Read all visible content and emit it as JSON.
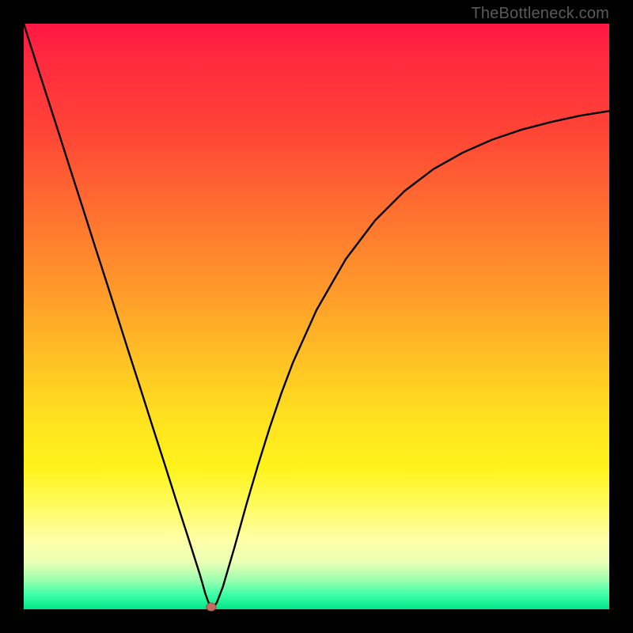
{
  "watermark": "TheBottleneck.com",
  "chart_data": {
    "type": "line",
    "title": "",
    "xlabel": "",
    "ylabel": "",
    "ylim": [
      0,
      100
    ],
    "xlim": [
      0,
      100
    ],
    "x": [
      0,
      2,
      4,
      6,
      8,
      10,
      12,
      14,
      16,
      18,
      20,
      22,
      24,
      26,
      28,
      30,
      30.5,
      31,
      31.5,
      32,
      32.5,
      33,
      34,
      36,
      38,
      40,
      42,
      44,
      46,
      50,
      55,
      60,
      65,
      70,
      75,
      80,
      85,
      90,
      95,
      100
    ],
    "values": [
      100,
      93.7,
      87.5,
      81.3,
      75.0,
      68.8,
      62.5,
      56.3,
      50.0,
      43.7,
      37.5,
      31.2,
      25.0,
      18.7,
      12.5,
      6.2,
      4.5,
      2.7,
      1.3,
      0.4,
      0.4,
      1.2,
      3.8,
      10.6,
      17.8,
      24.6,
      31.0,
      36.9,
      42.2,
      51.1,
      59.8,
      66.4,
      71.4,
      75.2,
      78.0,
      80.2,
      81.9,
      83.2,
      84.3,
      85.1
    ],
    "marker": {
      "x": 32,
      "y": 0.4
    },
    "grid": false,
    "legend": false
  },
  "colors": {
    "curve": "#000000",
    "marker_fill": "#c96a60",
    "marker_stroke": "#9a4f47",
    "background_top": "#ff1744",
    "background_bottom": "#00e58a"
  }
}
